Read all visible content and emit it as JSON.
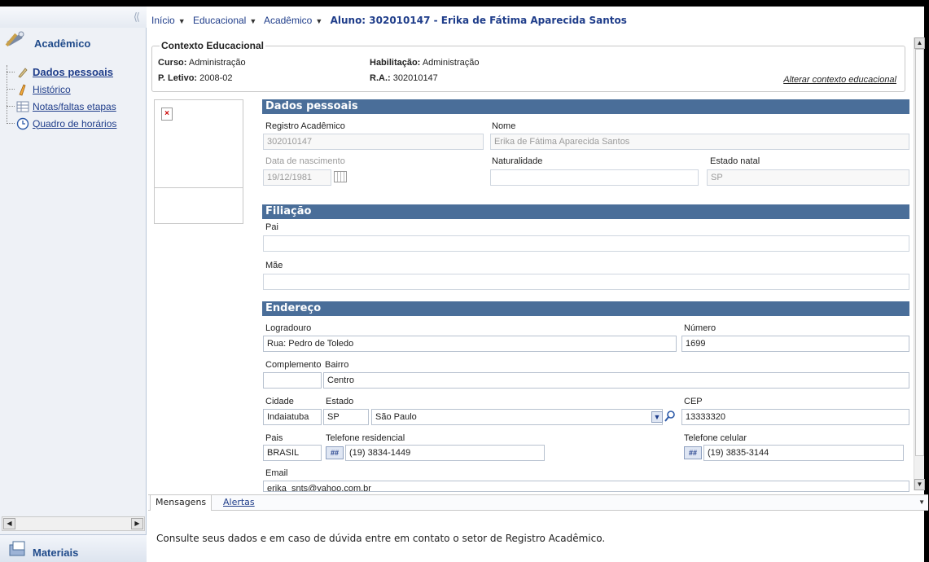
{
  "breadcrumb": {
    "home": "Início",
    "educacional": "Educacional",
    "academico": "Acadêmico",
    "current": "Aluno: 302010147 - Erika de Fátima Aparecida Santos"
  },
  "sidebar": {
    "collapse": "⟨⟨",
    "title": "Acadêmico",
    "items": [
      {
        "label": "Dados pessoais",
        "icon": "pencil-icon",
        "active": true
      },
      {
        "label": "Histórico",
        "icon": "pencil-icon",
        "active": false
      },
      {
        "label": "Notas/faltas etapas",
        "icon": "table-icon",
        "active": false
      },
      {
        "label": "Quadro de horários",
        "icon": "clock-icon",
        "active": false
      }
    ],
    "bottom_title": "Materiais"
  },
  "context": {
    "legend": "Contexto Educacional",
    "curso_label": "Curso:",
    "curso_value": "Administração",
    "habilitacao_label": "Habilitação:",
    "habilitacao_value": "Administração",
    "periodo_label": "P. Letivo:",
    "periodo_value": "2008-02",
    "ra_label": "R.A.:",
    "ra_value": "302010147",
    "alterar_link": "Alterar contexto educacional"
  },
  "sections": {
    "dados_pessoais": "Dados pessoais",
    "filiacao": "Filiação",
    "endereco": "Endereço"
  },
  "form": {
    "registro_label": "Registro Acadêmico",
    "registro_value": "302010147",
    "nome_label": "Nome",
    "nome_value": "Erika de Fátima Aparecida Santos",
    "nascimento_label": "Data de nascimento",
    "nascimento_value": "19/12/1981",
    "naturalidade_label": "Naturalidade",
    "naturalidade_value": "",
    "estado_natal_label": "Estado natal",
    "estado_natal_value": "SP",
    "pai_label": "Pai",
    "pai_value": "",
    "mae_label": "Mãe",
    "mae_value": "",
    "logradouro_label": "Logradouro",
    "logradouro_value": "Rua: Pedro de Toledo",
    "numero_label": "Número",
    "numero_value": "1699",
    "complemento_label": "Complemento",
    "complemento_value": "",
    "bairro_label": "Bairro",
    "bairro_value": "Centro",
    "cidade_label": "Cidade",
    "cidade_value": "Indaiatuba",
    "estado_label": "Estado",
    "estado_uf": "SP",
    "estado_nome": "São Paulo",
    "cep_label": "CEP",
    "cep_value": "13333320",
    "pais_label": "Pais",
    "pais_value": "BRASIL",
    "tel_res_label": "Telefone residencial",
    "tel_res_value": "(19) 3834-1449",
    "tel_cel_label": "Telefone celular",
    "tel_cel_value": "(19) 3835-3144",
    "email_label": "Email",
    "email_value": "erika_snts@yahoo.com.br"
  },
  "tabs": {
    "mensagens": "Mensagens",
    "alertas": "Alertas"
  },
  "message": "Consulte seus dados e em caso de dúvida entre em contato o setor de Registro Acadêmico."
}
